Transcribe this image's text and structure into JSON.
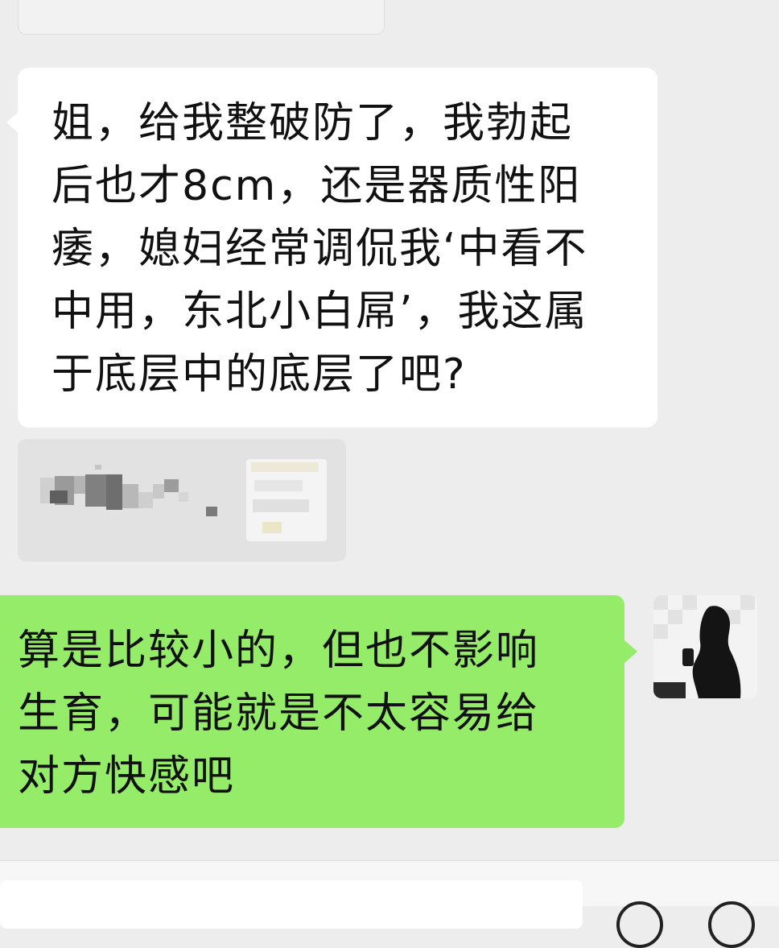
{
  "messages": [
    {
      "direction": "incoming",
      "type": "text",
      "text": "姐，给我整破防了，我勃起\n后也才8cm，还是器质性阳\n痿，媳妇经常调侃我‘中看不\n中用，东北小白屌’，我这属\n于底层中的底层了吧?"
    },
    {
      "direction": "incoming",
      "type": "shared-card",
      "blurred": true
    },
    {
      "direction": "outgoing",
      "type": "text",
      "text": "算是比较小的，但也不影响\n生育，可能就是不太容易给\n对方快感吧"
    }
  ],
  "colors": {
    "background": "#ededed",
    "incoming_bubble": "#ffffff",
    "outgoing_bubble": "#95ec69",
    "input_bar": "#f7f7f7"
  },
  "icons": {
    "left_button": "voice-icon",
    "right_buttons": [
      "emoji-icon",
      "plus-icon"
    ]
  }
}
